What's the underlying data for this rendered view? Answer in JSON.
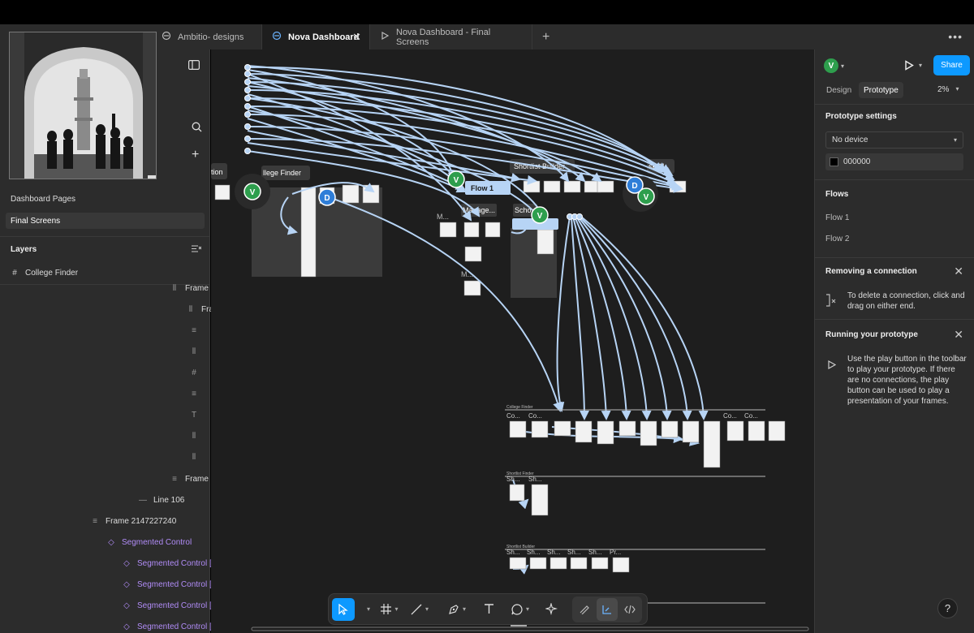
{
  "tabs": [
    {
      "label": "Ambitio- designs",
      "icon": "figma-file-icon"
    },
    {
      "label": "Nova Dashboard",
      "icon": "figma-file-icon",
      "active": true
    },
    {
      "label": "Nova Dashboard - Final Screens",
      "icon": "play-icon"
    }
  ],
  "pages": [
    {
      "label": "Dashboard Pages"
    },
    {
      "label": "Final Screens",
      "selected": true
    }
  ],
  "layers": {
    "title": "Layers",
    "root": "College Finder",
    "items": [
      {
        "label": "Frame",
        "icon": "frame-icon"
      },
      {
        "label": "Fra",
        "icon": "frame-icon"
      },
      {
        "label": "",
        "icon": "auto-layout-icon"
      },
      {
        "label": "",
        "icon": "frame-icon"
      },
      {
        "label": "",
        "icon": "grid-icon"
      },
      {
        "label": "",
        "icon": "auto-layout-icon"
      },
      {
        "label": "",
        "icon": "text-icon"
      },
      {
        "label": "",
        "icon": "frame-icon"
      },
      {
        "label": "",
        "icon": "frame-icon"
      },
      {
        "label": "Frame",
        "icon": "auto-layout-icon"
      },
      {
        "label": "Line 106",
        "icon": "line-icon"
      },
      {
        "label": "Frame 2147227240",
        "icon": "auto-layout-icon"
      },
      {
        "label": "Segmented Control",
        "icon": "component-icon"
      },
      {
        "label": "Segmented Control [",
        "icon": "component-icon"
      },
      {
        "label": "Segmented Control [",
        "icon": "component-icon"
      },
      {
        "label": "Segmented Control [",
        "icon": "component-icon"
      },
      {
        "label": "Segmented Control [",
        "icon": "component-icon"
      }
    ]
  },
  "canvas": {
    "frame_labels": {
      "section_left": "tion",
      "college_finder": "llege Finder",
      "shortlist_builder": "Shortlist Builder",
      "ask_ai": "sk AI",
      "flow1": "Flow 1",
      "manage": "Manage...",
      "scho": "Scho",
      "m1": "M...",
      "m2": "M...",
      "mini_college_finder": "College Finder",
      "mini_shortlist_finder": "Shortlist Finder",
      "mini_shortlist_builder": "Shortlist Builder",
      "row1": [
        "Co...",
        "Co...",
        "Co...",
        "Co..."
      ],
      "row2": [
        "Sh...",
        "Sh..."
      ],
      "row3": [
        "Sh...",
        "Sh...",
        "Sh...",
        "Sh...",
        "Sh...",
        "Pr..."
      ]
    },
    "avatars": [
      {
        "letter": "V",
        "color": "#2e9e4d"
      },
      {
        "letter": "D",
        "color": "#2f7ed8"
      },
      {
        "letter": "V",
        "color": "#2e9e4d"
      },
      {
        "letter": "V",
        "color": "#2e9e4d"
      },
      {
        "letter": "D",
        "color": "#2f7ed8"
      },
      {
        "letter": "V",
        "color": "#2e9e4d"
      }
    ]
  },
  "right_panel": {
    "user_avatar": "V",
    "share_label": "Share",
    "tab_design": "Design",
    "tab_prototype": "Prototype",
    "zoom": "2%",
    "prototype_settings_title": "Prototype settings",
    "device_select": "No device",
    "background_hex": "000000",
    "flows_title": "Flows",
    "flows": [
      "Flow 1",
      "Flow 2"
    ],
    "removing_title": "Removing a connection",
    "removing_text": "To delete a connection, click and drag on either end.",
    "running_title": "Running your prototype",
    "running_text": "Use the play button in the toolbar to play your prototype. If there are no connections, the play button can be used to play a presentation of your frames."
  },
  "toolbar": {
    "tools": [
      "move-tool",
      "frame-tool",
      "line-tool",
      "pen-tool",
      "text-tool",
      "comment-tool",
      "ai-tool"
    ],
    "modes": [
      "draw-mode",
      "design-mode",
      "dev-mode"
    ]
  },
  "help_label": "?",
  "colors": {
    "accent": "#0d99ff",
    "connection": "#b7d4f5",
    "canvas_bg": "#1e1e1e",
    "panel_bg": "#2c2c2c",
    "component": "#b18cf7"
  }
}
